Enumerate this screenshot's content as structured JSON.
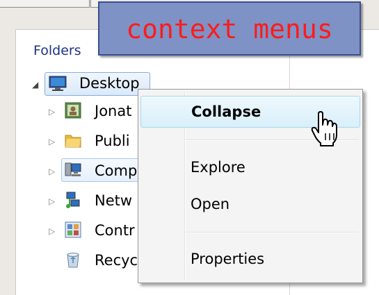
{
  "banner": {
    "text": "context menus"
  },
  "pane": {
    "title": "Folders"
  },
  "tree": {
    "root": {
      "label": "Desktop",
      "icon": "desktop-monitor-icon"
    },
    "children": [
      {
        "label": "Jonat",
        "icon": "user-folder-icon"
      },
      {
        "label": "Publi",
        "icon": "folder-icon"
      },
      {
        "label": "Comp",
        "icon": "computer-icon"
      },
      {
        "label": "Netw",
        "icon": "network-icon"
      },
      {
        "label": "Contr",
        "icon": "control-panel-icon"
      },
      {
        "label": "Recyc",
        "icon": "recycle-bin-icon"
      }
    ]
  },
  "context_menu": {
    "items": [
      {
        "label": "Collapse",
        "bold": true,
        "highlighted": true
      },
      {
        "label": "Explore"
      },
      {
        "label": "Open"
      },
      {
        "label": "Properties"
      }
    ]
  },
  "colors": {
    "banner_bg": "#7e92c6",
    "banner_text": "#ff1b1b",
    "selection": "#dbe9f9"
  }
}
